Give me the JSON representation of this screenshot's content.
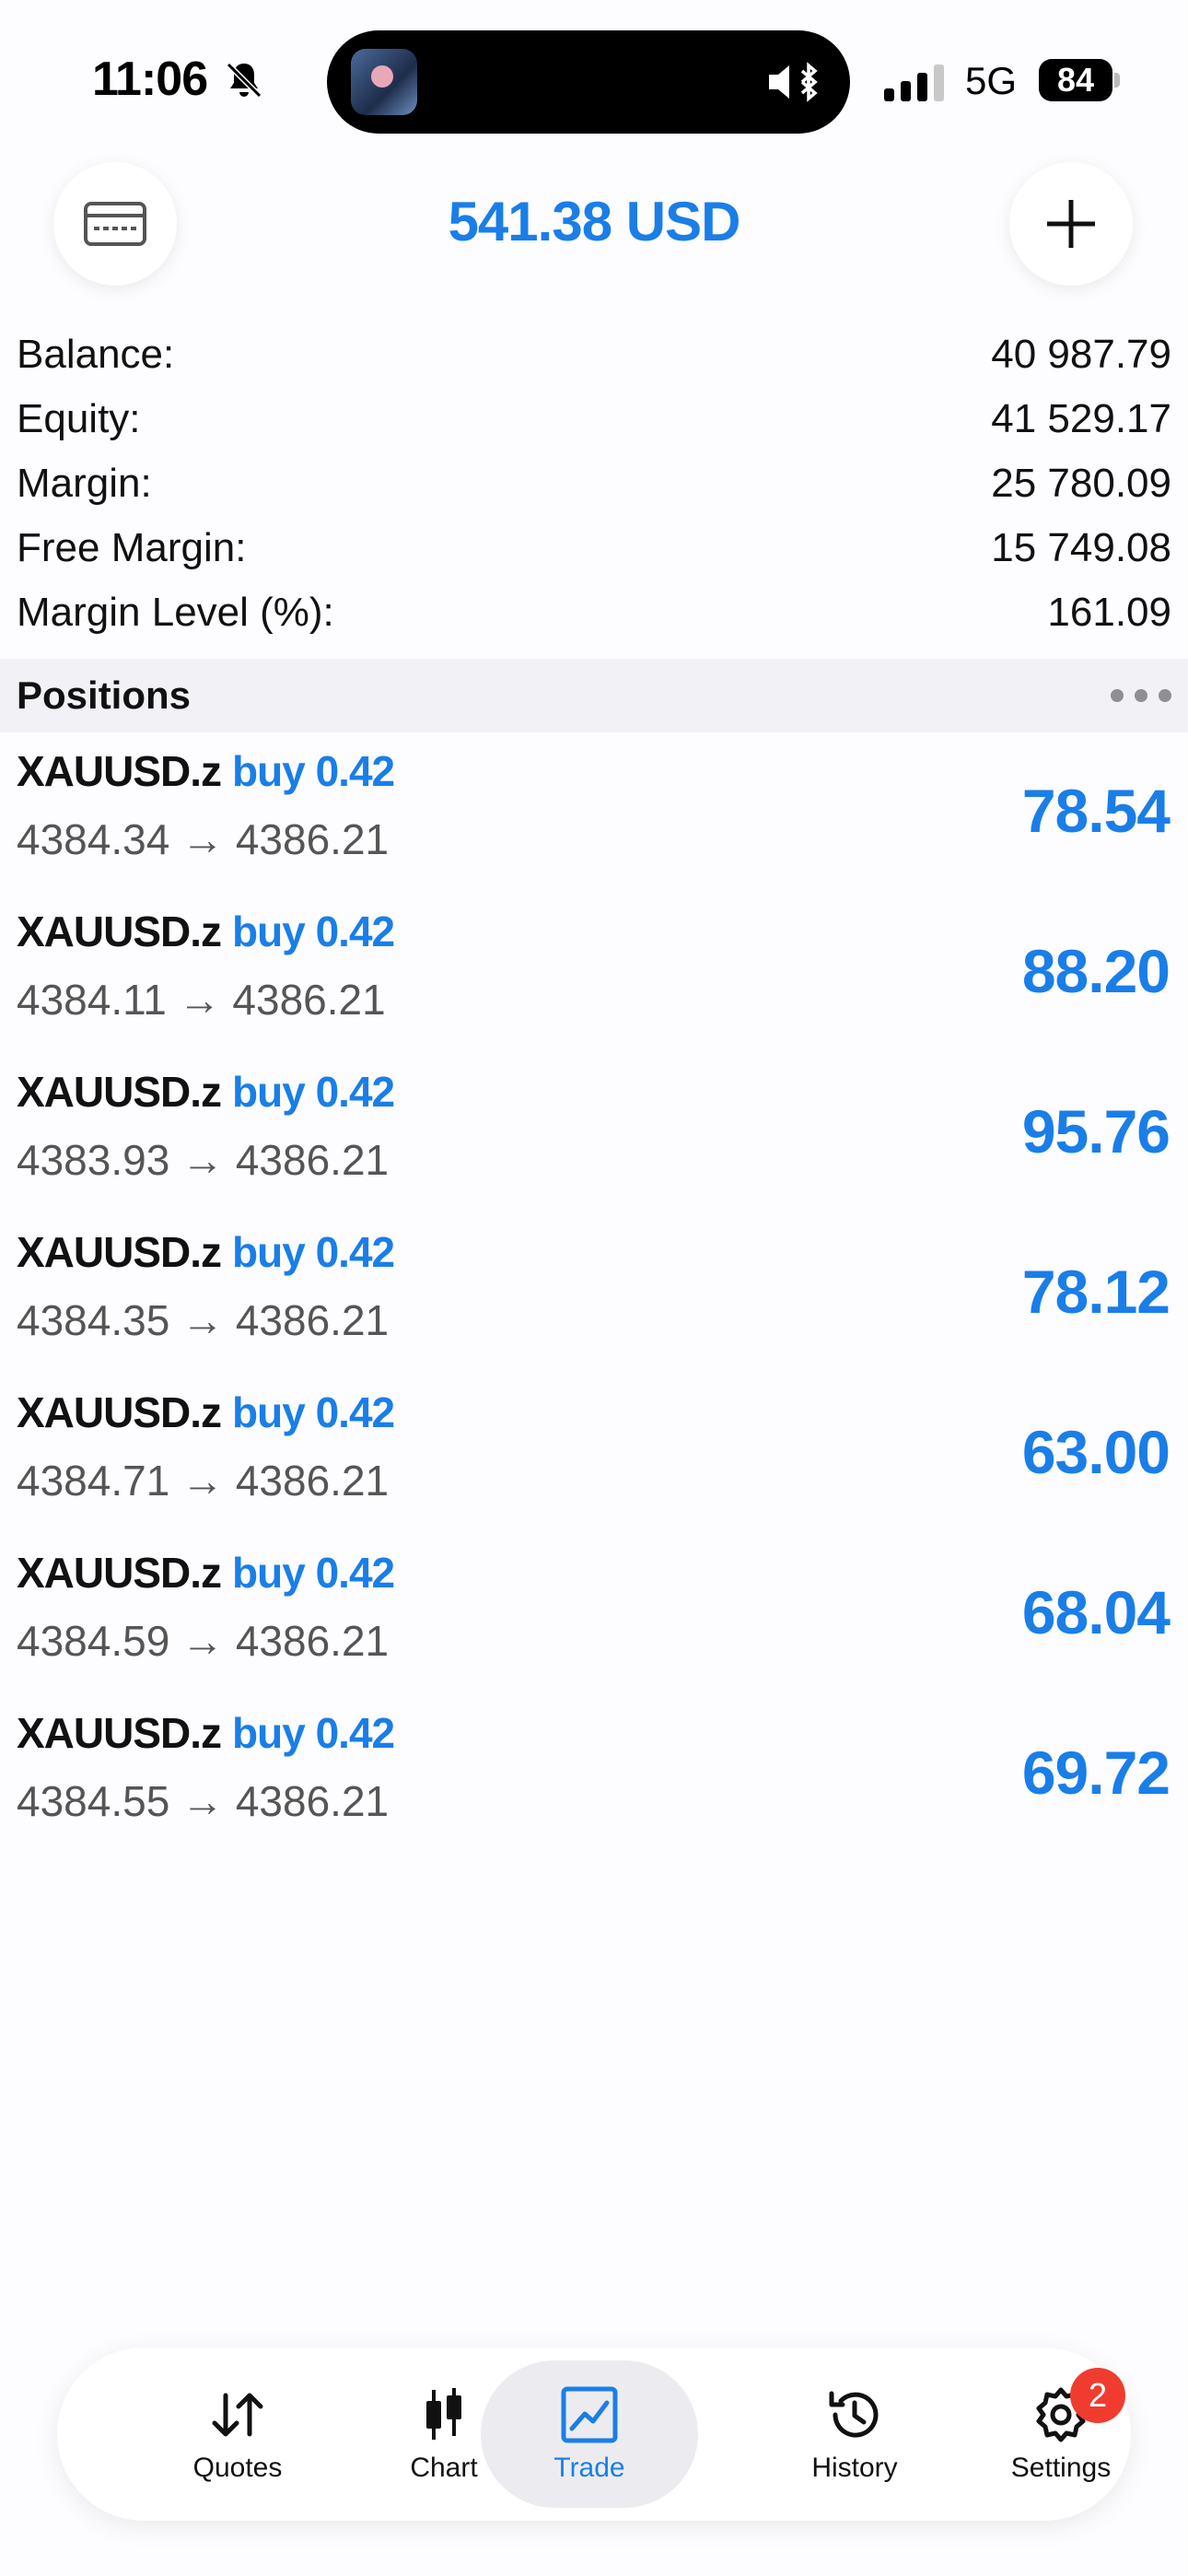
{
  "status_bar": {
    "time": "11:06",
    "network": "5G",
    "battery": "84"
  },
  "header": {
    "title": "541.38 USD"
  },
  "summary": [
    {
      "label": "Balance:",
      "value": "40 987.79"
    },
    {
      "label": "Equity:",
      "value": "41 529.17"
    },
    {
      "label": "Margin:",
      "value": "25 780.09"
    },
    {
      "label": "Free Margin:",
      "value": "15 749.08"
    },
    {
      "label": "Margin Level (%):",
      "value": "161.09"
    }
  ],
  "positions": {
    "title": "Positions",
    "items": [
      {
        "symbol": "XAUUSD.z",
        "side": "buy 0.42",
        "prices": "4384.34 → 4386.21",
        "profit": "78.54"
      },
      {
        "symbol": "XAUUSD.z",
        "side": "buy 0.42",
        "prices": "4384.11 → 4386.21",
        "profit": "88.20"
      },
      {
        "symbol": "XAUUSD.z",
        "side": "buy 0.42",
        "prices": "4383.93 → 4386.21",
        "profit": "95.76"
      },
      {
        "symbol": "XAUUSD.z",
        "side": "buy 0.42",
        "prices": "4384.35 → 4386.21",
        "profit": "78.12"
      },
      {
        "symbol": "XAUUSD.z",
        "side": "buy 0.42",
        "prices": "4384.71 → 4386.21",
        "profit": "63.00"
      },
      {
        "symbol": "XAUUSD.z",
        "side": "buy 0.42",
        "prices": "4384.59 → 4386.21",
        "profit": "68.04"
      },
      {
        "symbol": "XAUUSD.z",
        "side": "buy 0.42",
        "prices": "4384.55 → 4386.21",
        "profit": "69.72"
      }
    ]
  },
  "tabs": [
    {
      "label": "Quotes",
      "icon": "quotes-icon"
    },
    {
      "label": "Chart",
      "icon": "chart-icon"
    },
    {
      "label": "Trade",
      "icon": "trade-icon",
      "active": true
    },
    {
      "label": "History",
      "icon": "history-icon"
    },
    {
      "label": "Settings",
      "icon": "settings-icon",
      "badge": "2"
    }
  ],
  "colors": {
    "accent": "#1a7ee8",
    "badge": "#f03c2f"
  }
}
